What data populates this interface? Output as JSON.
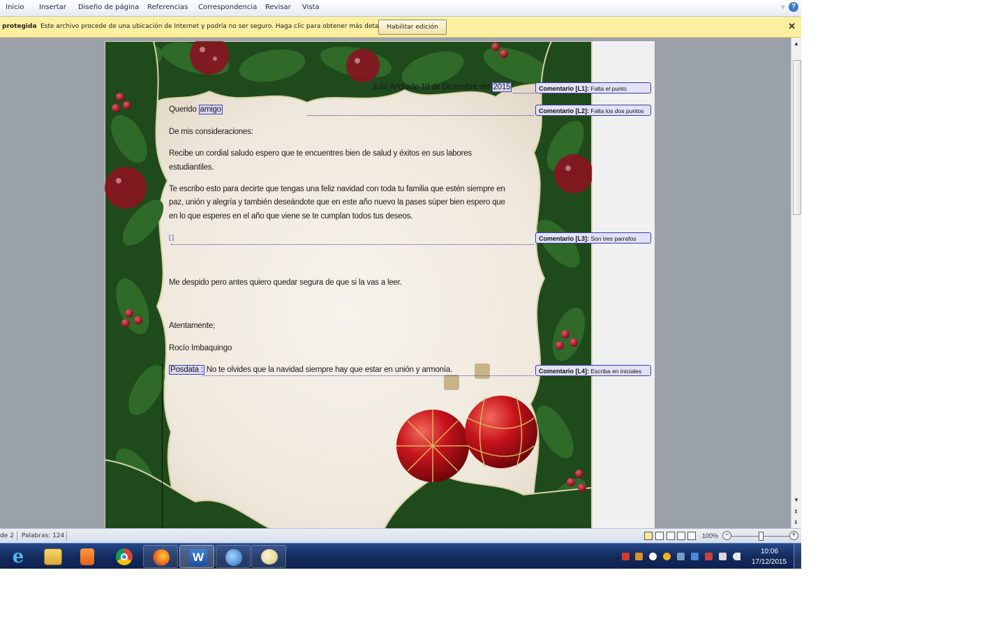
{
  "ribbon": {
    "tabs": [
      "Inicio",
      "Insertar",
      "Diseño de página",
      "Referencias",
      "Correspondencia",
      "Revisar",
      "Vista"
    ],
    "help_icon": "?"
  },
  "protected_view": {
    "title": "protegida",
    "message": "Este archivo procede de una ubicación de Internet y podría no ser seguro. Haga clic para obtener más detalles.",
    "enable_button": "Habilitar edición",
    "close_icon": "✕"
  },
  "document": {
    "date_line_prefix": "Julio Andrade 10 de Diciembre del ",
    "date_year": "2015",
    "greeting_prefix": "Querido ",
    "greeting_word": "amigo",
    "line_considerations": "De mis consideraciones:",
    "para1_l1": "Recibe un cordial saludo espero que te encuentres bien de salud y éxitos en sus labores",
    "para1_l2": "estudiantiles.",
    "para2_l1": "Te escribo esto para decirte que tengas una feliz navidad  con toda tu familia que estén siempre en",
    "para2_l2": "paz, unión y alegría y también deseándote que en este año nuevo la pases súper bien  espero que",
    "para2_l3": "en lo que esperes en el año que viene se te cumplan todos tus deseos.",
    "empty_marker": "[ ]",
    "farewell": "Me despido pero antes quiero quedar segura de que si la vas a leer.",
    "closing": "Atentamente;",
    "signature": "Rocío Imbaquingo",
    "postscript_label": "Posdata :",
    "postscript_text": " No te olvides  que la navidad siempre hay que estar en unión  y armonía."
  },
  "comments": [
    {
      "label": "Comentario [L1]:",
      "text": "Falta el punto"
    },
    {
      "label": "Comentario [L2]:",
      "text": "Falta los dos puntos"
    },
    {
      "label": "Comentario [L3]:",
      "text": "Son tres parrafos"
    },
    {
      "label": "Comentario [L4]:",
      "text": "Escriba en iniciales"
    }
  ],
  "statusbar": {
    "page_info": "de 2",
    "words": "Palabras: 124",
    "zoom": "100%",
    "zoom_level_percent": 100
  },
  "taskbar": {
    "apps": [
      "internet-explorer",
      "file-explorer",
      "media-player",
      "chrome",
      "firefox",
      "word",
      "network-app",
      "paint"
    ],
    "active_app": "word",
    "time": "10:06",
    "date": "17/12/2015"
  },
  "colors": {
    "protected_bar": "#fcf0a0",
    "comment_border": "#3b3ba8",
    "comment_fill": "#e2e2f8",
    "taskbar": "#12295a"
  }
}
